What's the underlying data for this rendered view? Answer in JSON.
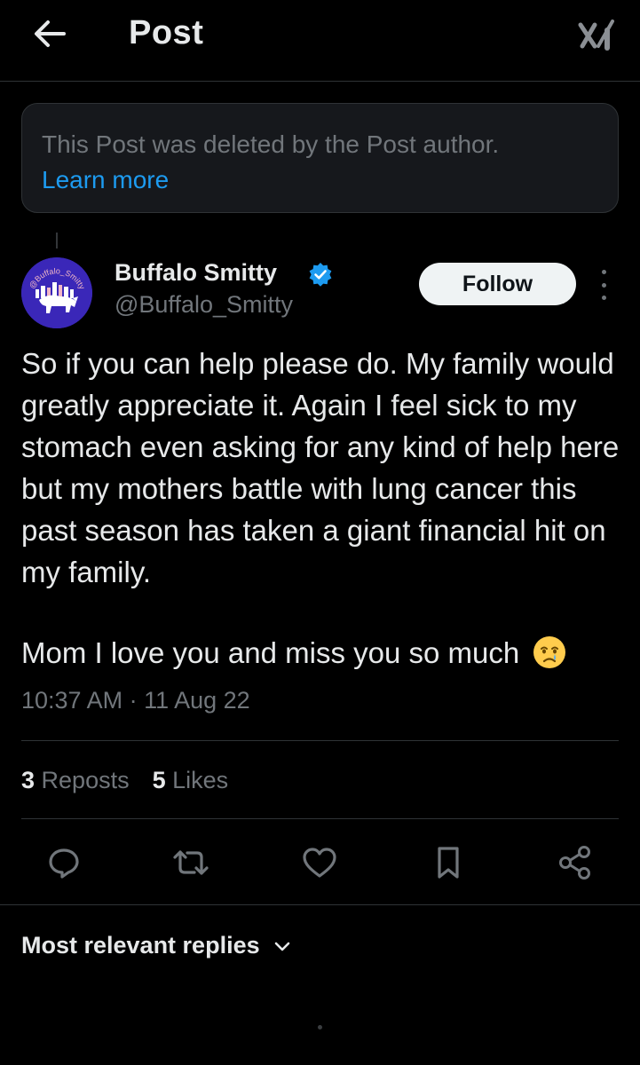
{
  "header": {
    "title": "Post",
    "back_icon": "arrow-left-icon",
    "brand_logo": "x-logo"
  },
  "notice": {
    "text": "This Post was deleted by the Post author.",
    "link": "Learn more"
  },
  "author": {
    "name": "Buffalo Smitty",
    "handle": "@Buffalo_Smitty",
    "avatar_text": "@Buffalo_Smitty",
    "verified": true,
    "follow_label": "Follow"
  },
  "post": {
    "paragraph1": "So if you can help please do. My family would greatly appreciate it. Again I feel sick to my stomach even asking for any kind of help here but my mothers battle with lung cancer this past season has taken a giant financial hit on my family.",
    "paragraph2": "Mom I love you and miss you so much",
    "emoji": "crying-face",
    "timestamp": "10:37 AM · 11 Aug 22"
  },
  "stats": {
    "reposts_count": "3",
    "reposts_label": "Reposts",
    "likes_count": "5",
    "likes_label": "Likes"
  },
  "actions": [
    "reply-icon",
    "repost-icon",
    "like-icon",
    "bookmark-icon",
    "share-icon"
  ],
  "replies": {
    "sort_label": "Most relevant replies"
  },
  "colors": {
    "background": "#000000",
    "text": "#e7e9ea",
    "muted": "#71767b",
    "accent": "#1d9bf0",
    "border": "#2f3336"
  }
}
